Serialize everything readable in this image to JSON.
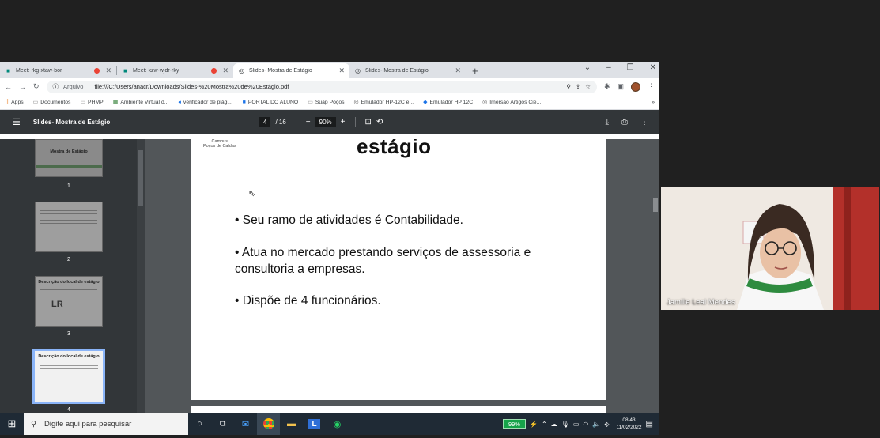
{
  "browser": {
    "tabs": [
      {
        "title": "Meet: rkg-xtaw-bor",
        "recording": true,
        "active": false
      },
      {
        "title": "Meet: kzw-wjdr-rky",
        "recording": true,
        "active": false
      },
      {
        "title": "Slides- Mostra de Estágio",
        "recording": false,
        "active": true
      },
      {
        "title": "Slides- Mostra de Estágio",
        "recording": false,
        "active": false
      }
    ],
    "address": {
      "scheme_label": "Arquivo",
      "url": "file:///C:/Users/anacr/Downloads/Slides-%20Mostra%20de%20Estágio.pdf"
    },
    "bookmarks": [
      "Apps",
      "Documentos",
      "PHMP",
      "Ambiente Virtual d...",
      "verificador de plági...",
      "PORTAL DO ALUNO",
      "Suap Poços",
      "Emulador HP-12C e...",
      "Emulador HP 12C",
      "Imersão Artigos Cie..."
    ]
  },
  "pdf": {
    "title": "Slides- Mostra de Estágio",
    "current_page": "4",
    "total_pages": "/ 16",
    "zoom": "90%",
    "thumbnails": [
      {
        "number": "1",
        "title": "Mostra de Estágio"
      },
      {
        "number": "2",
        "title": ""
      },
      {
        "number": "3",
        "title": "Descrição do local de estágio"
      },
      {
        "number": "4",
        "title": "Descrição do local de estágio"
      }
    ],
    "slide": {
      "campus_line1": "Campus",
      "campus_line2": "Poços de Caldas",
      "title": "estágio",
      "bullets": [
        "• Seu ramo de atividades é Contabilidade.",
        "•  Atua no mercado prestando serviços de assessoria e consultoria a empresas.",
        "• Dispõe de 4 funcionários."
      ]
    }
  },
  "webcam": {
    "participant_name": "Jamille Leal Mendes"
  },
  "taskbar": {
    "search_placeholder": "Digite aqui para pesquisar",
    "battery": "99%",
    "time": "08:43",
    "date": "11/02/2022"
  },
  "colors": {
    "pdf_toolbar": "#323639",
    "pdf_background": "#525659",
    "taskbar": "#1f2a35",
    "battery_green": "#16a34a"
  }
}
